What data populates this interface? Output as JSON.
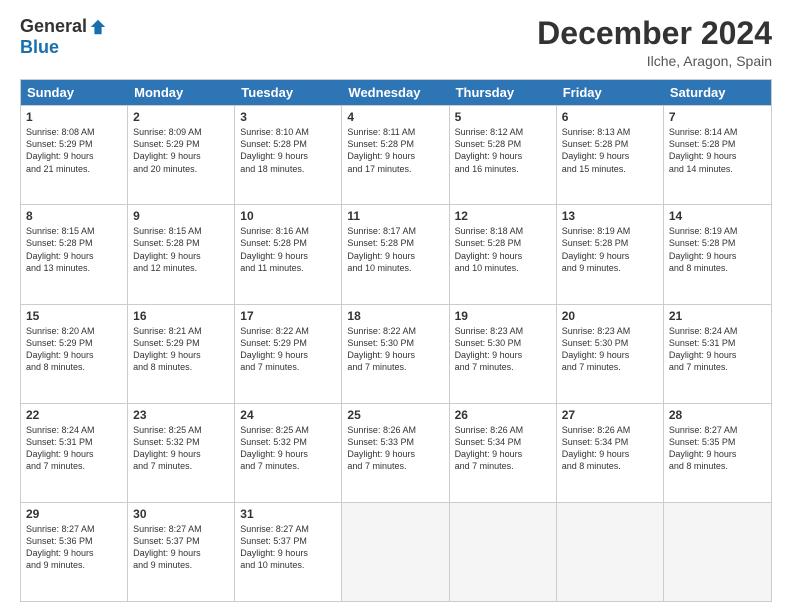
{
  "logo": {
    "general": "General",
    "blue": "Blue"
  },
  "header": {
    "month": "December 2024",
    "location": "Ilche, Aragon, Spain"
  },
  "days": [
    "Sunday",
    "Monday",
    "Tuesday",
    "Wednesday",
    "Thursday",
    "Friday",
    "Saturday"
  ],
  "rows": [
    [
      {
        "day": "1",
        "lines": [
          "Sunrise: 8:08 AM",
          "Sunset: 5:29 PM",
          "Daylight: 9 hours",
          "and 21 minutes."
        ]
      },
      {
        "day": "2",
        "lines": [
          "Sunrise: 8:09 AM",
          "Sunset: 5:29 PM",
          "Daylight: 9 hours",
          "and 20 minutes."
        ]
      },
      {
        "day": "3",
        "lines": [
          "Sunrise: 8:10 AM",
          "Sunset: 5:28 PM",
          "Daylight: 9 hours",
          "and 18 minutes."
        ]
      },
      {
        "day": "4",
        "lines": [
          "Sunrise: 8:11 AM",
          "Sunset: 5:28 PM",
          "Daylight: 9 hours",
          "and 17 minutes."
        ]
      },
      {
        "day": "5",
        "lines": [
          "Sunrise: 8:12 AM",
          "Sunset: 5:28 PM",
          "Daylight: 9 hours",
          "and 16 minutes."
        ]
      },
      {
        "day": "6",
        "lines": [
          "Sunrise: 8:13 AM",
          "Sunset: 5:28 PM",
          "Daylight: 9 hours",
          "and 15 minutes."
        ]
      },
      {
        "day": "7",
        "lines": [
          "Sunrise: 8:14 AM",
          "Sunset: 5:28 PM",
          "Daylight: 9 hours",
          "and 14 minutes."
        ]
      }
    ],
    [
      {
        "day": "8",
        "lines": [
          "Sunrise: 8:15 AM",
          "Sunset: 5:28 PM",
          "Daylight: 9 hours",
          "and 13 minutes."
        ]
      },
      {
        "day": "9",
        "lines": [
          "Sunrise: 8:15 AM",
          "Sunset: 5:28 PM",
          "Daylight: 9 hours",
          "and 12 minutes."
        ]
      },
      {
        "day": "10",
        "lines": [
          "Sunrise: 8:16 AM",
          "Sunset: 5:28 PM",
          "Daylight: 9 hours",
          "and 11 minutes."
        ]
      },
      {
        "day": "11",
        "lines": [
          "Sunrise: 8:17 AM",
          "Sunset: 5:28 PM",
          "Daylight: 9 hours",
          "and 10 minutes."
        ]
      },
      {
        "day": "12",
        "lines": [
          "Sunrise: 8:18 AM",
          "Sunset: 5:28 PM",
          "Daylight: 9 hours",
          "and 10 minutes."
        ]
      },
      {
        "day": "13",
        "lines": [
          "Sunrise: 8:19 AM",
          "Sunset: 5:28 PM",
          "Daylight: 9 hours",
          "and 9 minutes."
        ]
      },
      {
        "day": "14",
        "lines": [
          "Sunrise: 8:19 AM",
          "Sunset: 5:28 PM",
          "Daylight: 9 hours",
          "and 8 minutes."
        ]
      }
    ],
    [
      {
        "day": "15",
        "lines": [
          "Sunrise: 8:20 AM",
          "Sunset: 5:29 PM",
          "Daylight: 9 hours",
          "and 8 minutes."
        ]
      },
      {
        "day": "16",
        "lines": [
          "Sunrise: 8:21 AM",
          "Sunset: 5:29 PM",
          "Daylight: 9 hours",
          "and 8 minutes."
        ]
      },
      {
        "day": "17",
        "lines": [
          "Sunrise: 8:22 AM",
          "Sunset: 5:29 PM",
          "Daylight: 9 hours",
          "and 7 minutes."
        ]
      },
      {
        "day": "18",
        "lines": [
          "Sunrise: 8:22 AM",
          "Sunset: 5:30 PM",
          "Daylight: 9 hours",
          "and 7 minutes."
        ]
      },
      {
        "day": "19",
        "lines": [
          "Sunrise: 8:23 AM",
          "Sunset: 5:30 PM",
          "Daylight: 9 hours",
          "and 7 minutes."
        ]
      },
      {
        "day": "20",
        "lines": [
          "Sunrise: 8:23 AM",
          "Sunset: 5:30 PM",
          "Daylight: 9 hours",
          "and 7 minutes."
        ]
      },
      {
        "day": "21",
        "lines": [
          "Sunrise: 8:24 AM",
          "Sunset: 5:31 PM",
          "Daylight: 9 hours",
          "and 7 minutes."
        ]
      }
    ],
    [
      {
        "day": "22",
        "lines": [
          "Sunrise: 8:24 AM",
          "Sunset: 5:31 PM",
          "Daylight: 9 hours",
          "and 7 minutes."
        ]
      },
      {
        "day": "23",
        "lines": [
          "Sunrise: 8:25 AM",
          "Sunset: 5:32 PM",
          "Daylight: 9 hours",
          "and 7 minutes."
        ]
      },
      {
        "day": "24",
        "lines": [
          "Sunrise: 8:25 AM",
          "Sunset: 5:32 PM",
          "Daylight: 9 hours",
          "and 7 minutes."
        ]
      },
      {
        "day": "25",
        "lines": [
          "Sunrise: 8:26 AM",
          "Sunset: 5:33 PM",
          "Daylight: 9 hours",
          "and 7 minutes."
        ]
      },
      {
        "day": "26",
        "lines": [
          "Sunrise: 8:26 AM",
          "Sunset: 5:34 PM",
          "Daylight: 9 hours",
          "and 7 minutes."
        ]
      },
      {
        "day": "27",
        "lines": [
          "Sunrise: 8:26 AM",
          "Sunset: 5:34 PM",
          "Daylight: 9 hours",
          "and 8 minutes."
        ]
      },
      {
        "day": "28",
        "lines": [
          "Sunrise: 8:27 AM",
          "Sunset: 5:35 PM",
          "Daylight: 9 hours",
          "and 8 minutes."
        ]
      }
    ],
    [
      {
        "day": "29",
        "lines": [
          "Sunrise: 8:27 AM",
          "Sunset: 5:36 PM",
          "Daylight: 9 hours",
          "and 9 minutes."
        ]
      },
      {
        "day": "30",
        "lines": [
          "Sunrise: 8:27 AM",
          "Sunset: 5:37 PM",
          "Daylight: 9 hours",
          "and 9 minutes."
        ]
      },
      {
        "day": "31",
        "lines": [
          "Sunrise: 8:27 AM",
          "Sunset: 5:37 PM",
          "Daylight: 9 hours",
          "and 10 minutes."
        ]
      },
      {
        "day": "",
        "lines": []
      },
      {
        "day": "",
        "lines": []
      },
      {
        "day": "",
        "lines": []
      },
      {
        "day": "",
        "lines": []
      }
    ]
  ]
}
